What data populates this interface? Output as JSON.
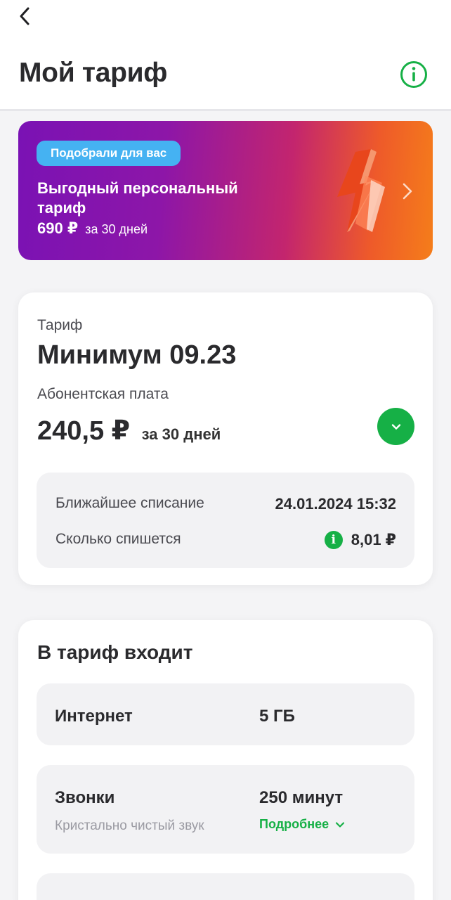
{
  "header": {
    "title": "Мой тариф",
    "back_icon": "chevron-left-icon",
    "info_icon": "info-circle-icon"
  },
  "promo": {
    "badge": "Подобрали для вас",
    "title": "Выгодный персональный тариф",
    "price": "690 ₽",
    "period": "за 30 дней"
  },
  "tariff": {
    "label": "Тариф",
    "name": "Минимум 09.23",
    "fee_label": "Абонентская плата",
    "fee_value": "240,5 ₽",
    "fee_period": "за 30 дней",
    "billing": {
      "next_charge_label": "Ближайшее списание",
      "next_charge_value": "24.01.2024 15:32",
      "amount_label": "Сколько спишется",
      "amount_value": "8,01 ₽"
    }
  },
  "includes": {
    "title": "В тариф входит",
    "items": [
      {
        "name": "Интернет",
        "value": "5 ГБ"
      },
      {
        "name": "Звонки",
        "value": "250 минут",
        "subtitle": "Кристально чистый звук",
        "link": "Подробнее"
      }
    ]
  },
  "colors": {
    "accent_green": "#16b046",
    "badge_blue": "#45b2f2",
    "promo_purple": "#7a12b4",
    "promo_orange": "#f57d1a"
  }
}
